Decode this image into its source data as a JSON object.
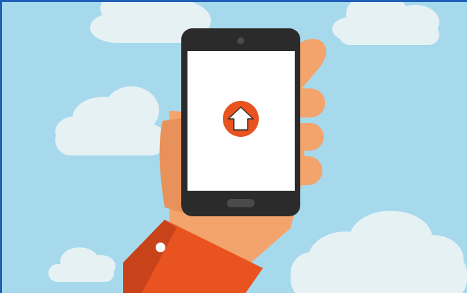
{
  "scene": {
    "description_icon": "home-upload-icon",
    "colors": {
      "sky": "#a6d9ec",
      "cloud": "#e6f1f4",
      "cloud_shadow": "#d6e8ee",
      "skin": "#f3a36c",
      "skin_shadow": "#e8915a",
      "sleeve": "#e8531f",
      "sleeve_shadow": "#c9431a",
      "button": "#ffffff",
      "phone_body": "#2c2b2b",
      "phone_screen": "#ffffff",
      "phone_home_button": "#4a4a4a",
      "badge": "#e8531f",
      "frame_border": "#1f5fb5"
    }
  }
}
